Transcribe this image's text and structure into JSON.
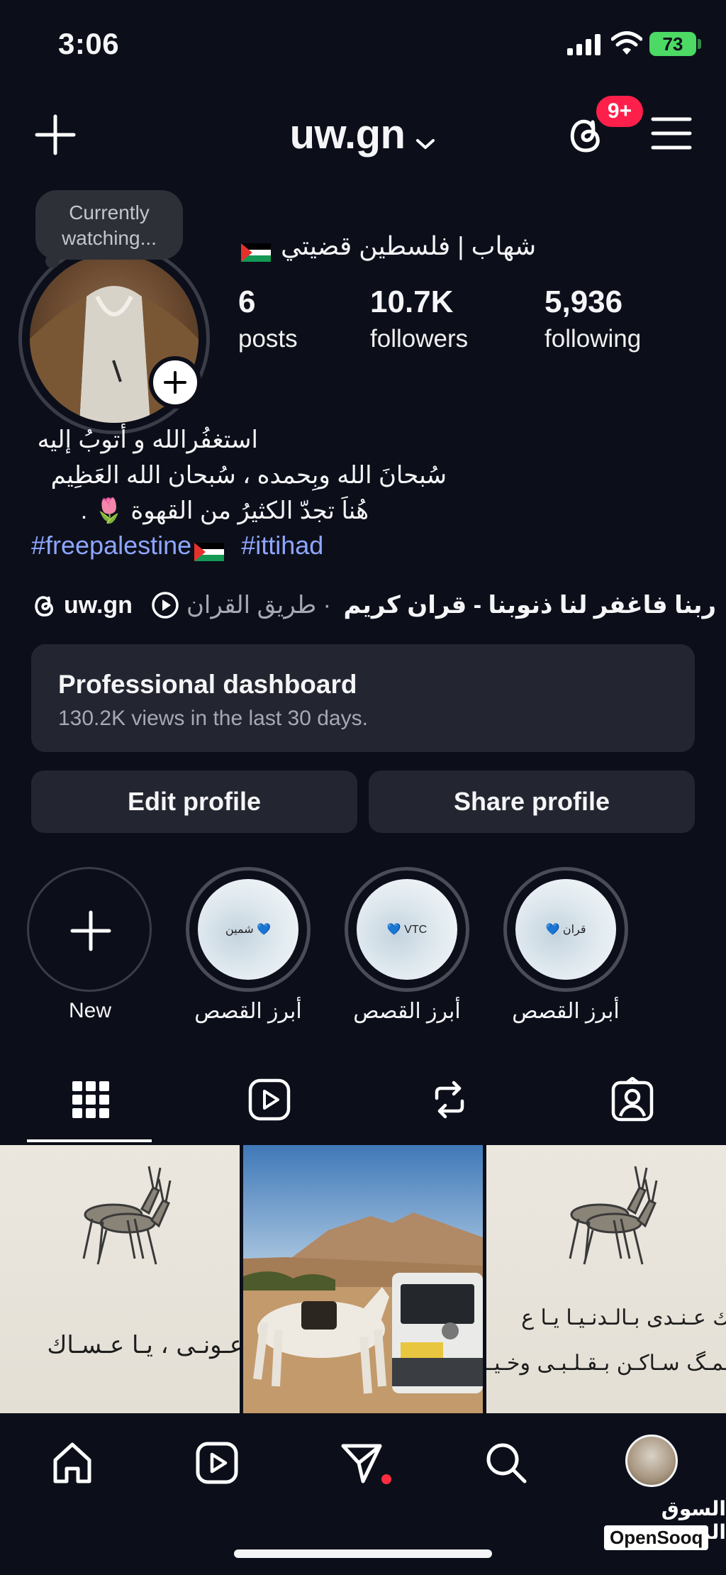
{
  "status_bar": {
    "time": "3:06",
    "battery": "73"
  },
  "header": {
    "username": "uw.gn",
    "notification_badge": "9+"
  },
  "profile": {
    "note": "Currently watching...",
    "display_name": "شهاب | فلسطين قضيتي",
    "stats": {
      "posts_count": "6",
      "posts_label": "posts",
      "followers_count": "10.7K",
      "followers_label": "followers",
      "following_count": "5,936",
      "following_label": "following"
    },
    "bio": {
      "line1": "استغفُرالله و أتوبُ إليه",
      "line2": "سُبحانَ الله وبِحمده ، سُبحان الله العَظِيم",
      "line3": "هُناَ تجدّ الكثيرُ من القهوة 🌷 .",
      "hashtag1": "#freepalestine",
      "hashtag2": "#ittihad"
    },
    "links": {
      "threads_handle": "uw.gn",
      "audio_title": "ربنا فاغفر لنا ذنوبنا - قران كريم",
      "audio_artist": "· طريق القران"
    }
  },
  "dashboard": {
    "title": "Professional dashboard",
    "subtitle": "130.2K views in the last 30 days."
  },
  "buttons": {
    "edit": "Edit profile",
    "share": "Share profile"
  },
  "highlights": [
    {
      "label": "New"
    },
    {
      "label": "أبرز القصص",
      "cover_text": "شمين 💙"
    },
    {
      "label": "أبرز القصص",
      "cover_text": "💙 VTC"
    },
    {
      "label": "أبرز القصص",
      "cover_text": "💙 قران"
    }
  ],
  "grid": {
    "post1_line1": "عـونـى ، يـا عـسـاك",
    "post3_line1": "ك عـنـدى بـالـدنـيـا يـا ع",
    "post3_line2": "ـمـگ سـاكـن بـقـلـبـى وخـيـا"
  },
  "watermark": {
    "arabic": "السوق المفتوح",
    "english": "OpenSooq"
  },
  "colors": {
    "background": "#0c0f1a",
    "card": "#232631",
    "link": "#8ea6ff",
    "badge": "#ff1f4b",
    "battery": "#4cd964"
  }
}
